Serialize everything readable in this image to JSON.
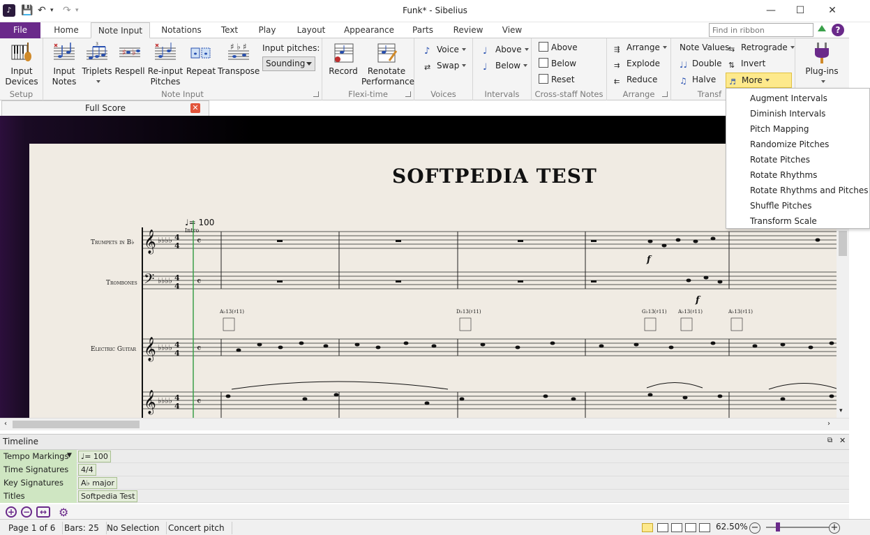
{
  "window": {
    "title": "Funk* - Sibelius",
    "app_icon": "sibelius-icon",
    "controls": {
      "minimize": "—",
      "maximize": "☐",
      "close": "✕"
    }
  },
  "quick_access": {
    "save": "save-icon",
    "undo": "undo-icon",
    "redo": "redo-icon"
  },
  "tabs": [
    {
      "label": "File"
    },
    {
      "label": "Home"
    },
    {
      "label": "Note Input"
    },
    {
      "label": "Notations"
    },
    {
      "label": "Text"
    },
    {
      "label": "Play"
    },
    {
      "label": "Layout"
    },
    {
      "label": "Appearance"
    },
    {
      "label": "Parts"
    },
    {
      "label": "Review"
    },
    {
      "label": "View"
    }
  ],
  "active_tab": "Note Input",
  "ribbon_search": {
    "placeholder": "Find in ribbon"
  },
  "ribbon": {
    "setup": {
      "label": "Setup",
      "input_devices": "Input\nDevices"
    },
    "note_input": {
      "label": "Note Input",
      "input_notes": "Input\nNotes",
      "triplets": "Triplets",
      "respell": "Respell",
      "reinput": "Re-input\nPitches",
      "repeat": "Repeat",
      "transpose": "Transpose",
      "input_pitches_label": "Input pitches:",
      "input_pitches_value": "Sounding"
    },
    "flexi_time": {
      "label": "Flexi-time",
      "record": "Record",
      "renotate": "Renotate\nPerformance"
    },
    "voices": {
      "label": "Voices",
      "voice": "Voice",
      "swap": "Swap"
    },
    "intervals": {
      "label": "Intervals",
      "above": "Above",
      "below": "Below"
    },
    "cross_staff": {
      "label": "Cross-staff Notes",
      "above": "Above",
      "below": "Below",
      "reset": "Reset"
    },
    "arrange": {
      "label": "Arrange",
      "arrange": "Arrange",
      "explode": "Explode",
      "reduce": "Reduce"
    },
    "transform": {
      "label": "Transf",
      "note_values": "Note Values",
      "double": "Double",
      "halve": "Halve",
      "retrograde": "Retrograde",
      "invert": "Invert",
      "more": "More"
    },
    "plugins": {
      "label": "Plug-ins"
    }
  },
  "more_menu": [
    "Augment Intervals",
    "Diminish Intervals",
    "Pitch Mapping",
    "Randomize Pitches",
    "Rotate Pitches",
    "Rotate Rhythms",
    "Rotate Rhythms and Pitches",
    "Shuffle Pitches",
    "Transform Scale"
  ],
  "document_tab": {
    "label": "Full Score"
  },
  "score": {
    "title": "SOFTPEDIA  TEST",
    "tempo": "♩= 100",
    "intro": "Intro",
    "instruments": [
      "Trumpets in B♭",
      "Trombones",
      "Electric Guitar"
    ],
    "chords": [
      "A♭13(♯11)",
      "D♭13(♯11)",
      "G♭13(♯11)",
      "A♭13(♯11)",
      "A♭13(♯11)"
    ]
  },
  "timeline": {
    "title": "Timeline",
    "rows": [
      {
        "label": "Tempo Markings",
        "value": "♩= 100"
      },
      {
        "label": "Time Signatures",
        "value": "4/4"
      },
      {
        "label": "Key Signatures",
        "value": "A♭ major"
      },
      {
        "label": "Titles",
        "value": "Softpedia Test"
      }
    ]
  },
  "status": {
    "page": "Page 1 of 6",
    "bars": "Bars: 25",
    "selection": "No Selection",
    "pitch": "Concert pitch",
    "zoom": "62.50%"
  },
  "colors": {
    "accent": "#6a2a8a",
    "highlight": "#fde98c",
    "paper": "#f0ebe3"
  }
}
